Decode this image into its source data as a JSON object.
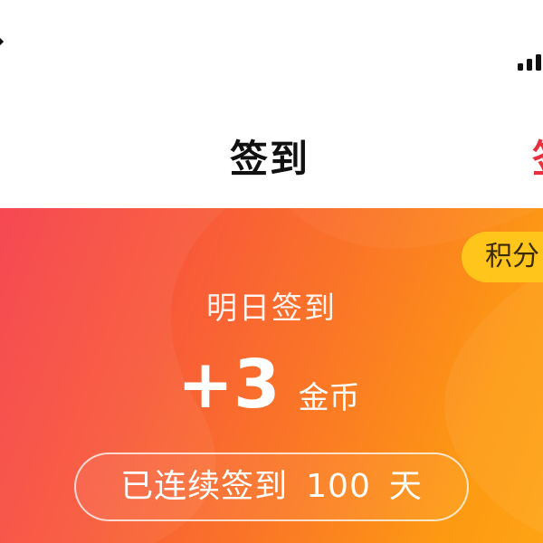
{
  "header": {
    "title": "签到",
    "right_partial_label": "签"
  },
  "banner": {
    "points_button_label": "积分",
    "tomorrow_label": "明日签到",
    "reward_amount": "+3",
    "reward_unit": "金币",
    "streak": {
      "prefix": "已连续签到",
      "count": "100",
      "suffix": "天"
    },
    "colors": {
      "gradient_start": "#f63f4a",
      "gradient_end": "#fea314",
      "points_pill": "#ffc51a",
      "accent_red": "#e8303c"
    }
  },
  "icons": {
    "status_left": "status-glyph-icon",
    "signal": "signal-strength-icon"
  }
}
